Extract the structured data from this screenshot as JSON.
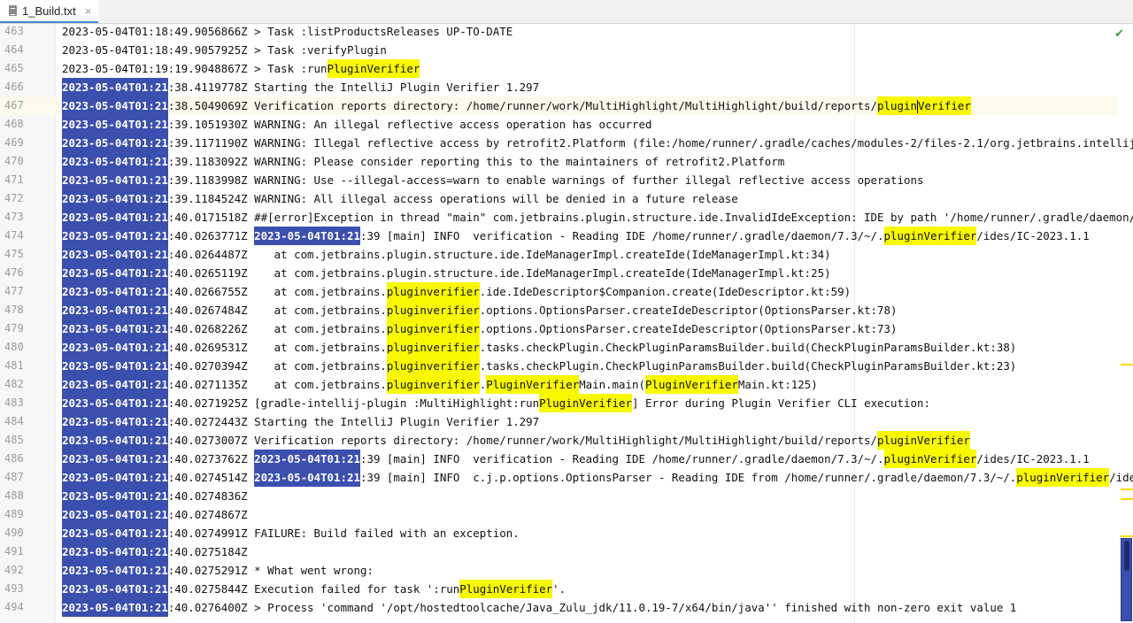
{
  "tab": {
    "title": "1_Build.txt",
    "icon": "text-file-icon",
    "close": "×"
  },
  "inspection": {
    "icon": "check-icon",
    "glyph": "✔",
    "color": "#3a9a3a"
  },
  "colors": {
    "selection_blue": "#3b4fae",
    "highlight_yellow": "#f8f800",
    "caret_line": "#fcfaec"
  },
  "caret_line": 467,
  "lines": [
    {
      "n": "463",
      "segs": [
        [
          "2023-05-04T01:18:49.9056866Z > Task :listProductsReleases UP-TO-DATE",
          ""
        ]
      ]
    },
    {
      "n": "464",
      "segs": [
        [
          "2023-05-04T01:18:49.9057925Z > Task :verifyPlugin",
          ""
        ]
      ]
    },
    {
      "n": "465",
      "segs": [
        [
          "2023-05-04T01:19:19.9048867Z > Task :run",
          ""
        ],
        [
          "PluginVerifier",
          "y"
        ]
      ]
    },
    {
      "n": "466",
      "segs": [
        [
          "2023-05-04T01:21",
          "b"
        ],
        [
          ":38.4119778Z Starting the IntelliJ Plugin Verifier 1.297",
          ""
        ]
      ]
    },
    {
      "n": "467",
      "segs": [
        [
          "2023-05-04T01:21",
          "b"
        ],
        [
          ":38.5049069Z Verification reports directory: /home/runner/work/MultiHighlight/MultiHighlight/build/reports/",
          ""
        ],
        [
          "plugin",
          "y"
        ],
        [
          "|",
          "c"
        ],
        [
          "Verifier",
          "y"
        ]
      ]
    },
    {
      "n": "468",
      "segs": [
        [
          "2023-05-04T01:21",
          "b"
        ],
        [
          ":39.1051930Z WARNING: An illegal reflective access operation has occurred",
          ""
        ]
      ]
    },
    {
      "n": "469",
      "segs": [
        [
          "2023-05-04T01:21",
          "b"
        ],
        [
          ":39.1171190Z WARNING: Illegal reflective access by retrofit2.Platform (file:/home/runner/.gradle/caches/modules-2/files-2.1/org.jetbrains.intellij",
          ""
        ]
      ]
    },
    {
      "n": "470",
      "segs": [
        [
          "2023-05-04T01:21",
          "b"
        ],
        [
          ":39.1183092Z WARNING: Please consider reporting this to the maintainers of retrofit2.Platform",
          ""
        ]
      ]
    },
    {
      "n": "471",
      "segs": [
        [
          "2023-05-04T01:21",
          "b"
        ],
        [
          ":39.1183998Z WARNING: Use --illegal-access=warn to enable warnings of further illegal reflective access operations",
          ""
        ]
      ]
    },
    {
      "n": "472",
      "segs": [
        [
          "2023-05-04T01:21",
          "b"
        ],
        [
          ":39.1184524Z WARNING: All illegal access operations will be denied in a future release",
          ""
        ]
      ]
    },
    {
      "n": "473",
      "segs": [
        [
          "2023-05-04T01:21",
          "b"
        ],
        [
          ":40.0171518Z ##[error]Exception in thread \"main\" com.jetbrains.plugin.structure.ide.InvalidIdeException: IDE by path '/home/runner/.gradle/daemon/7",
          ""
        ]
      ]
    },
    {
      "n": "474",
      "segs": [
        [
          "2023-05-04T01:21",
          "b"
        ],
        [
          ":40.0263771Z ",
          ""
        ],
        [
          "2023-05-04T01:21",
          "b"
        ],
        [
          ":39 [main] INFO  verification - Reading IDE /home/runner/.gradle/daemon/7.3/~/.",
          ""
        ],
        [
          "pluginVerifier",
          "y"
        ],
        [
          "/ides/IC-2023.1.1",
          ""
        ]
      ]
    },
    {
      "n": "475",
      "segs": [
        [
          "2023-05-04T01:21",
          "b"
        ],
        [
          ":40.0264487Z    at com.jetbrains.plugin.structure.ide.IdeManagerImpl.createIde(IdeManagerImpl.kt:34)",
          ""
        ]
      ]
    },
    {
      "n": "476",
      "segs": [
        [
          "2023-05-04T01:21",
          "b"
        ],
        [
          ":40.0265119Z    at com.jetbrains.plugin.structure.ide.IdeManagerImpl.createIde(IdeManagerImpl.kt:25)",
          ""
        ]
      ]
    },
    {
      "n": "477",
      "segs": [
        [
          "2023-05-04T01:21",
          "b"
        ],
        [
          ":40.0266755Z    at com.jetbrains.",
          ""
        ],
        [
          "pluginverifier",
          "y"
        ],
        [
          ".ide.IdeDescriptor$Companion.create(IdeDescriptor.kt:59)",
          ""
        ]
      ]
    },
    {
      "n": "478",
      "segs": [
        [
          "2023-05-04T01:21",
          "b"
        ],
        [
          ":40.0267484Z    at com.jetbrains.",
          ""
        ],
        [
          "pluginverifier",
          "y"
        ],
        [
          ".options.OptionsParser.createIdeDescriptor(OptionsParser.kt:78)",
          ""
        ]
      ]
    },
    {
      "n": "479",
      "segs": [
        [
          "2023-05-04T01:21",
          "b"
        ],
        [
          ":40.0268226Z    at com.jetbrains.",
          ""
        ],
        [
          "pluginverifier",
          "y"
        ],
        [
          ".options.OptionsParser.createIdeDescriptor(OptionsParser.kt:73)",
          ""
        ]
      ]
    },
    {
      "n": "480",
      "segs": [
        [
          "2023-05-04T01:21",
          "b"
        ],
        [
          ":40.0269531Z    at com.jetbrains.",
          ""
        ],
        [
          "pluginverifier",
          "y"
        ],
        [
          ".tasks.checkPlugin.CheckPluginParamsBuilder.build(CheckPluginParamsBuilder.kt:38)",
          ""
        ]
      ]
    },
    {
      "n": "481",
      "segs": [
        [
          "2023-05-04T01:21",
          "b"
        ],
        [
          ":40.0270394Z    at com.jetbrains.",
          ""
        ],
        [
          "pluginverifier",
          "y"
        ],
        [
          ".tasks.checkPlugin.CheckPluginParamsBuilder.build(CheckPluginParamsBuilder.kt:23)",
          ""
        ]
      ]
    },
    {
      "n": "482",
      "segs": [
        [
          "2023-05-04T01:21",
          "b"
        ],
        [
          ":40.0271135Z    at com.jetbrains.",
          ""
        ],
        [
          "pluginverifier",
          "y"
        ],
        [
          ".",
          ""
        ],
        [
          "PluginVerifier",
          "y"
        ],
        [
          "Main.main(",
          ""
        ],
        [
          "PluginVerifier",
          "y"
        ],
        [
          "Main.kt:125)",
          ""
        ]
      ]
    },
    {
      "n": "483",
      "segs": [
        [
          "2023-05-04T01:21",
          "b"
        ],
        [
          ":40.0271925Z [gradle-intellij-plugin :MultiHighlight:run",
          ""
        ],
        [
          "PluginVerifier",
          "y"
        ],
        [
          "] Error during Plugin Verifier CLI execution:",
          ""
        ]
      ]
    },
    {
      "n": "484",
      "segs": [
        [
          "2023-05-04T01:21",
          "b"
        ],
        [
          ":40.0272443Z Starting the IntelliJ Plugin Verifier 1.297",
          ""
        ]
      ]
    },
    {
      "n": "485",
      "segs": [
        [
          "2023-05-04T01:21",
          "b"
        ],
        [
          ":40.0273007Z Verification reports directory: /home/runner/work/MultiHighlight/MultiHighlight/build/reports/",
          ""
        ],
        [
          "pluginVerifier",
          "y"
        ]
      ]
    },
    {
      "n": "486",
      "segs": [
        [
          "2023-05-04T01:21",
          "b"
        ],
        [
          ":40.0273762Z ",
          ""
        ],
        [
          "2023-05-04T01:21",
          "b"
        ],
        [
          ":39 [main] INFO  verification - Reading IDE /home/runner/.gradle/daemon/7.3/~/.",
          ""
        ],
        [
          "pluginVerifier",
          "y"
        ],
        [
          "/ides/IC-2023.1.1",
          ""
        ]
      ]
    },
    {
      "n": "487",
      "segs": [
        [
          "2023-05-04T01:21",
          "b"
        ],
        [
          ":40.0274514Z ",
          ""
        ],
        [
          "2023-05-04T01:21",
          "b"
        ],
        [
          ":39 [main] INFO  c.j.p.options.OptionsParser - Reading IDE from /home/runner/.gradle/daemon/7.3/~/.",
          ""
        ],
        [
          "pluginVerifier",
          "y"
        ],
        [
          "/ide",
          ""
        ]
      ]
    },
    {
      "n": "488",
      "segs": [
        [
          "2023-05-04T01:21",
          "b"
        ],
        [
          ":40.0274836Z",
          ""
        ]
      ]
    },
    {
      "n": "489",
      "segs": [
        [
          "2023-05-04T01:21",
          "b"
        ],
        [
          ":40.0274867Z",
          ""
        ]
      ]
    },
    {
      "n": "490",
      "segs": [
        [
          "2023-05-04T01:21",
          "b"
        ],
        [
          ":40.0274991Z FAILURE: Build failed with an exception.",
          ""
        ]
      ]
    },
    {
      "n": "491",
      "segs": [
        [
          "2023-05-04T01:21",
          "b"
        ],
        [
          ":40.0275184Z",
          ""
        ]
      ]
    },
    {
      "n": "492",
      "segs": [
        [
          "2023-05-04T01:21",
          "b"
        ],
        [
          ":40.0275291Z * What went wrong:",
          ""
        ]
      ]
    },
    {
      "n": "493",
      "segs": [
        [
          "2023-05-04T01:21",
          "b"
        ],
        [
          ":40.0275844Z Execution failed for task ':run",
          ""
        ],
        [
          "PluginVerifier",
          "y"
        ],
        [
          "'.",
          ""
        ]
      ]
    },
    {
      "n": "494",
      "segs": [
        [
          "2023-05-04T01:21",
          "b"
        ],
        [
          ":40.0276400Z > Process 'command '/opt/hostedtoolcache/Java_Zulu_jdk/11.0.19-7/x64/bin/java'' finished with non-zero exit value 1",
          ""
        ]
      ]
    }
  ]
}
